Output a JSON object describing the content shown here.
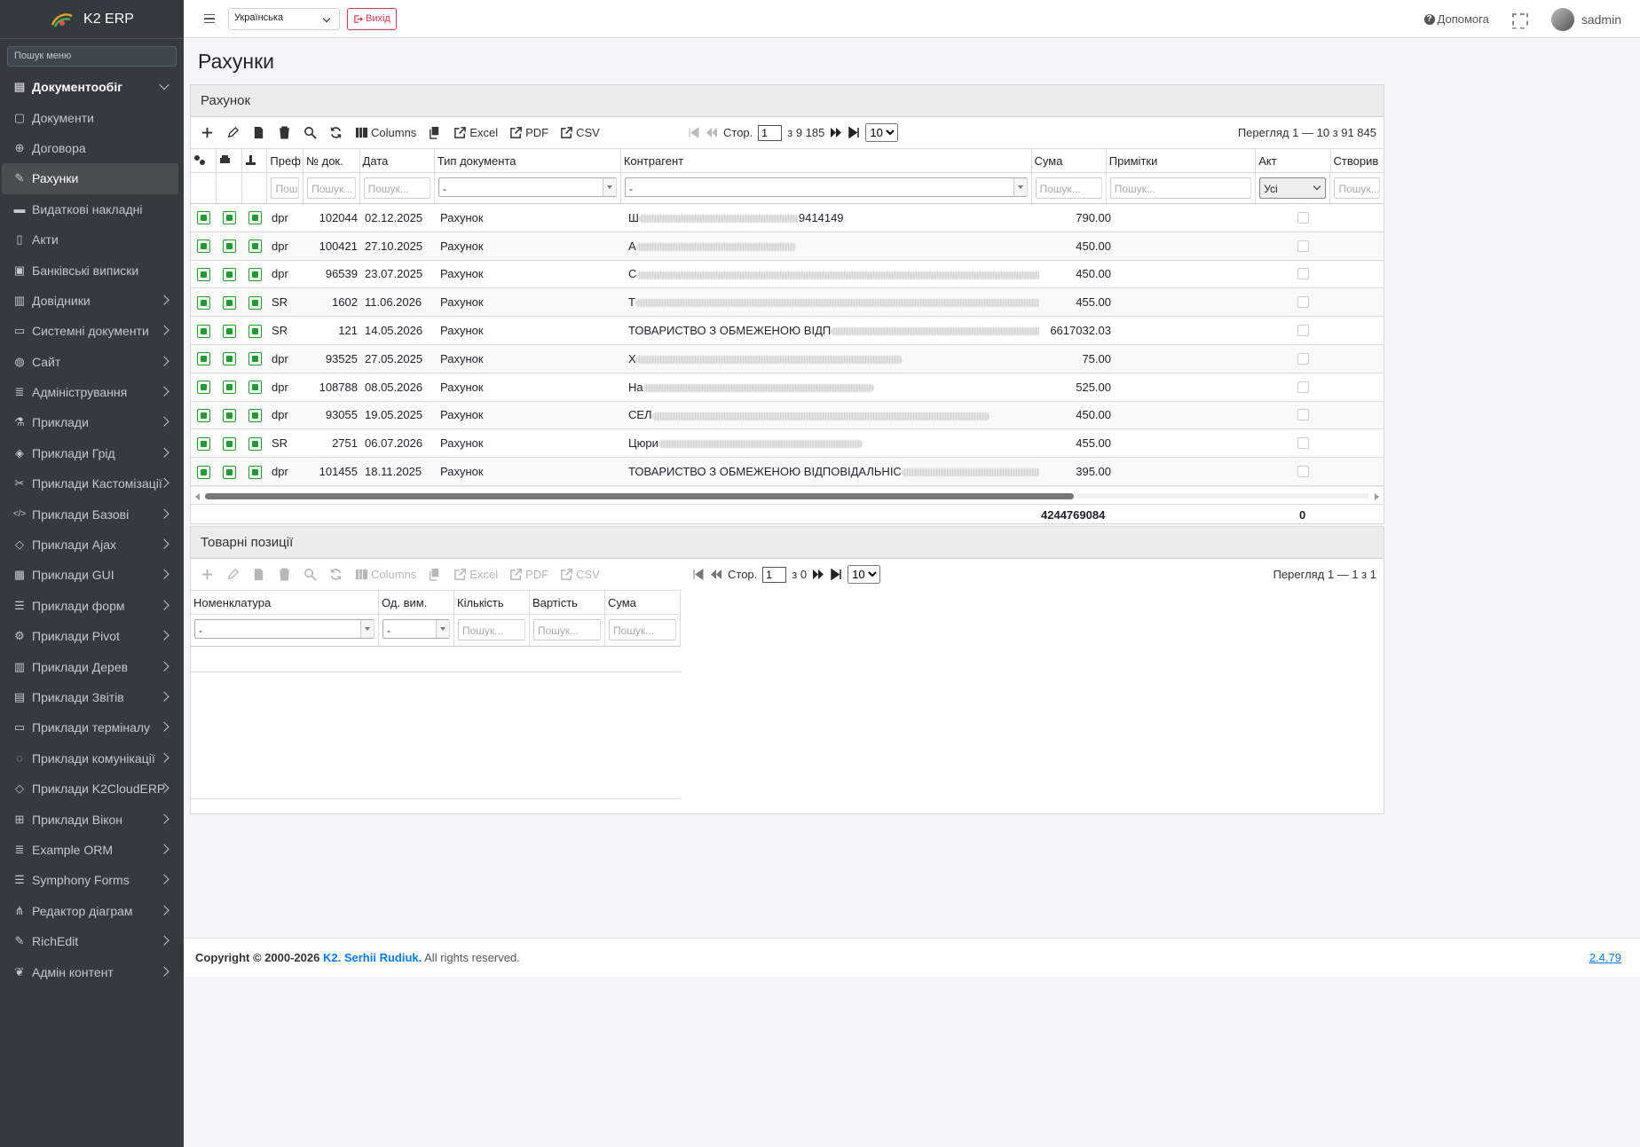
{
  "app": {
    "name": "K2 ERP"
  },
  "sidebar": {
    "search_placeholder": "Пошук меню",
    "items": [
      {
        "label": "Документообіг",
        "icon": "book-icon",
        "open": true
      },
      {
        "label": "Документи",
        "icon": "file-icon"
      },
      {
        "label": "Договора",
        "icon": "handshake-icon"
      },
      {
        "label": "Рахунки",
        "icon": "invoice-icon",
        "active": true
      },
      {
        "label": "Видаткові накладні",
        "icon": "minus-icon"
      },
      {
        "label": "Акти",
        "icon": "doc-icon"
      },
      {
        "label": "Банківські виписки",
        "icon": "money-icon"
      },
      {
        "label": "Довідники",
        "icon": "books-icon"
      },
      {
        "label": "Системні документи",
        "icon": "laptop-icon"
      },
      {
        "label": "Сайт",
        "icon": "globe-icon"
      },
      {
        "label": "Адміністрування",
        "icon": "database-icon"
      },
      {
        "label": "Приклади",
        "icon": "flask-icon"
      },
      {
        "label": "Приклади Грід",
        "icon": "cube-icon"
      },
      {
        "label": "Приклади Кастомізації",
        "icon": "tools-icon"
      },
      {
        "label": "Приклади Базові",
        "icon": "code-icon"
      },
      {
        "label": "Приклади Ajax",
        "icon": "cube-outline-icon"
      },
      {
        "label": "Приклади GUI",
        "icon": "window-icon"
      },
      {
        "label": "Приклади форм",
        "icon": "form-icon"
      },
      {
        "label": "Приклади Pivot",
        "icon": "pivot-icon"
      },
      {
        "label": "Приклади Дерев",
        "icon": "tree-icon"
      },
      {
        "label": "Приклади Звітів",
        "icon": "chart-icon"
      },
      {
        "label": "Приклади терміналу",
        "icon": "terminal-icon"
      },
      {
        "label": "Приклади комунікації",
        "icon": "comment-icon"
      },
      {
        "label": "Приклади K2CloudERP",
        "icon": "cube-outline-icon"
      },
      {
        "label": "Приклади Вікон",
        "icon": "windows-icon"
      },
      {
        "label": "Example ORM",
        "icon": "database-icon"
      },
      {
        "label": "Symphony Forms",
        "icon": "form-icon"
      },
      {
        "label": "Редактор діаграм",
        "icon": "sitemap-icon"
      },
      {
        "label": "RichEdit",
        "icon": "edit-icon"
      },
      {
        "label": "Адмін контент",
        "icon": "leaf-icon"
      }
    ]
  },
  "topbar": {
    "language": "Українська",
    "logout_label": "Вихід",
    "help_label": "Допомога",
    "username": "sadmin"
  },
  "page": {
    "title": "Рахунки"
  },
  "grid": {
    "caption": "Рахунок",
    "toolbar": {
      "columns": "Columns",
      "excel": "Excel",
      "pdf": "PDF",
      "csv": "CSV"
    },
    "pager": {
      "page_label": "Стор.",
      "page": "1",
      "of_label": "з 9 185",
      "rows": "10",
      "view": "Перегляд 1 — 10 з 91 845"
    },
    "headers": [
      "Преф",
      "№ док.",
      "Дата",
      "Тип документа",
      "Контрагент",
      "Сума",
      "Примітки",
      "Акт",
      "Створив"
    ],
    "filters": {
      "search_placeholder": "Пошук...",
      "search_short": "Пош",
      "select_default": "-",
      "akt_filter": "Усі"
    },
    "rows": [
      {
        "pref": "dpr",
        "num": "102044",
        "date": "02.12.2025",
        "type": "Рахунок",
        "contr_pre": "Ш",
        "contr_post": "9414149",
        "sum": "790.00"
      },
      {
        "pref": "dpr",
        "num": "100421",
        "date": "27.10.2025",
        "type": "Рахунок",
        "contr_pre": "А",
        "contr_post": "",
        "sum": "450.00"
      },
      {
        "pref": "dpr",
        "num": "96539",
        "date": "23.07.2025",
        "type": "Рахунок",
        "contr_pre": "С",
        "contr_post": "",
        "sum": "450.00"
      },
      {
        "pref": "SR",
        "num": "1602",
        "date": "11.06.2026",
        "type": "Рахунок",
        "contr_pre": "Т",
        "contr_post": "",
        "sum": "455.00"
      },
      {
        "pref": "SR",
        "num": "121",
        "date": "14.05.2026",
        "type": "Рахунок",
        "contr_pre": "ТОВАРИСТВО З ОБМЕЖЕНОЮ ВІДП",
        "contr_post": "Е...",
        "sum": "6617032.03"
      },
      {
        "pref": "dpr",
        "num": "93525",
        "date": "27.05.2025",
        "type": "Рахунок",
        "contr_pre": "Х",
        "contr_post": "",
        "sum": "75.00"
      },
      {
        "pref": "dpr",
        "num": "108788",
        "date": "08.05.2026",
        "type": "Рахунок",
        "contr_pre": "На",
        "contr_post": "",
        "sum": "525.00"
      },
      {
        "pref": "dpr",
        "num": "93055",
        "date": "19.05.2025",
        "type": "Рахунок",
        "contr_pre": "СЕЛ",
        "contr_post": "",
        "sum": "450.00"
      },
      {
        "pref": "SR",
        "num": "2751",
        "date": "06.07.2026",
        "type": "Рахунок",
        "contr_pre": "Цюри",
        "contr_post": "",
        "sum": "455.00"
      },
      {
        "pref": "dpr",
        "num": "101455",
        "date": "18.11.2025",
        "type": "Рахунок",
        "contr_pre": "ТОВАРИСТВО З ОБМЕЖЕНОЮ ВІДПОВІДАЛЬНІС",
        "contr_post": "З...",
        "sum": "395.00"
      }
    ],
    "totals": {
      "sum": "4244769084",
      "akt": "0"
    }
  },
  "items_grid": {
    "caption": "Товарні позиції",
    "toolbar": {
      "columns": "Columns",
      "excel": "Excel",
      "pdf": "PDF",
      "csv": "CSV"
    },
    "pager": {
      "page_label": "Стор.",
      "page": "1",
      "of_label": "з 0",
      "rows": "10",
      "view": "Перегляд 1 — 1 з 1"
    },
    "headers": [
      "Номенклатура",
      "Од. вим.",
      "Кількість",
      "Вартість",
      "Сума"
    ],
    "filters": {
      "search_placeholder": "Пошук...",
      "select_default": "-"
    }
  },
  "footer": {
    "copyright": "Copyright © 2000-2026",
    "author": "K2. Serhii Rudiuk.",
    "rights": "All rights reserved.",
    "version": "2.4.79"
  },
  "colors": {
    "sidebar_bg": "#343a40",
    "accent_green": "#1e9c2f",
    "danger": "#dc3545",
    "link": "#007bff"
  }
}
